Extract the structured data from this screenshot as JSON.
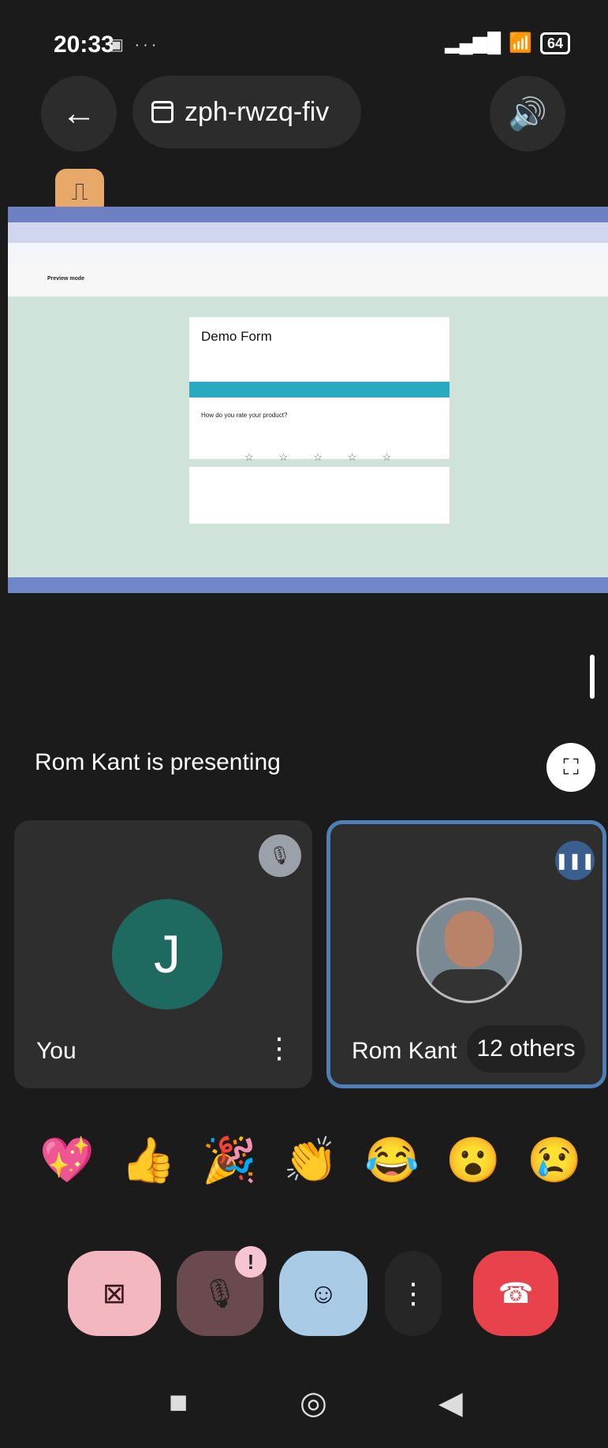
{
  "status_bar": {
    "time": "20:33",
    "left_icons": "▣ ···",
    "signal": "▂▄▆█",
    "wifi": "📶",
    "battery": "64"
  },
  "top_bar": {
    "back_icon": "←",
    "meeting_code": "zph-rwzq-fiv",
    "speaker_icon": "🔊"
  },
  "app_icon": "⎍",
  "shared_screen": {
    "page_header": "Preview mode",
    "form_title": "Demo Form",
    "form_question": "How do you rate your product?",
    "stars": "☆☆☆☆☆"
  },
  "presenting_text": "Rom Kant is presenting",
  "fullscreen_icon": "⛶",
  "tiles": {
    "you": {
      "initial": "J",
      "label": "You",
      "more_icon": "⋮",
      "mute_icon": "🎙"
    },
    "rom": {
      "label": "Rom Kant",
      "others": "12 others",
      "speaking_icon": "❚❚❚"
    }
  },
  "reactions": [
    "💖",
    "👍",
    "🎉",
    "👏",
    "😂",
    "😮",
    "😢"
  ],
  "controls": {
    "camera_icon": "⊠",
    "mic_icon": "🎙",
    "mic_alert": "!",
    "emoji_icon": "☺",
    "more_icon": "⋮",
    "end_icon": "☎"
  },
  "nav": {
    "home": "■",
    "circle": "◎",
    "back": "◀"
  }
}
